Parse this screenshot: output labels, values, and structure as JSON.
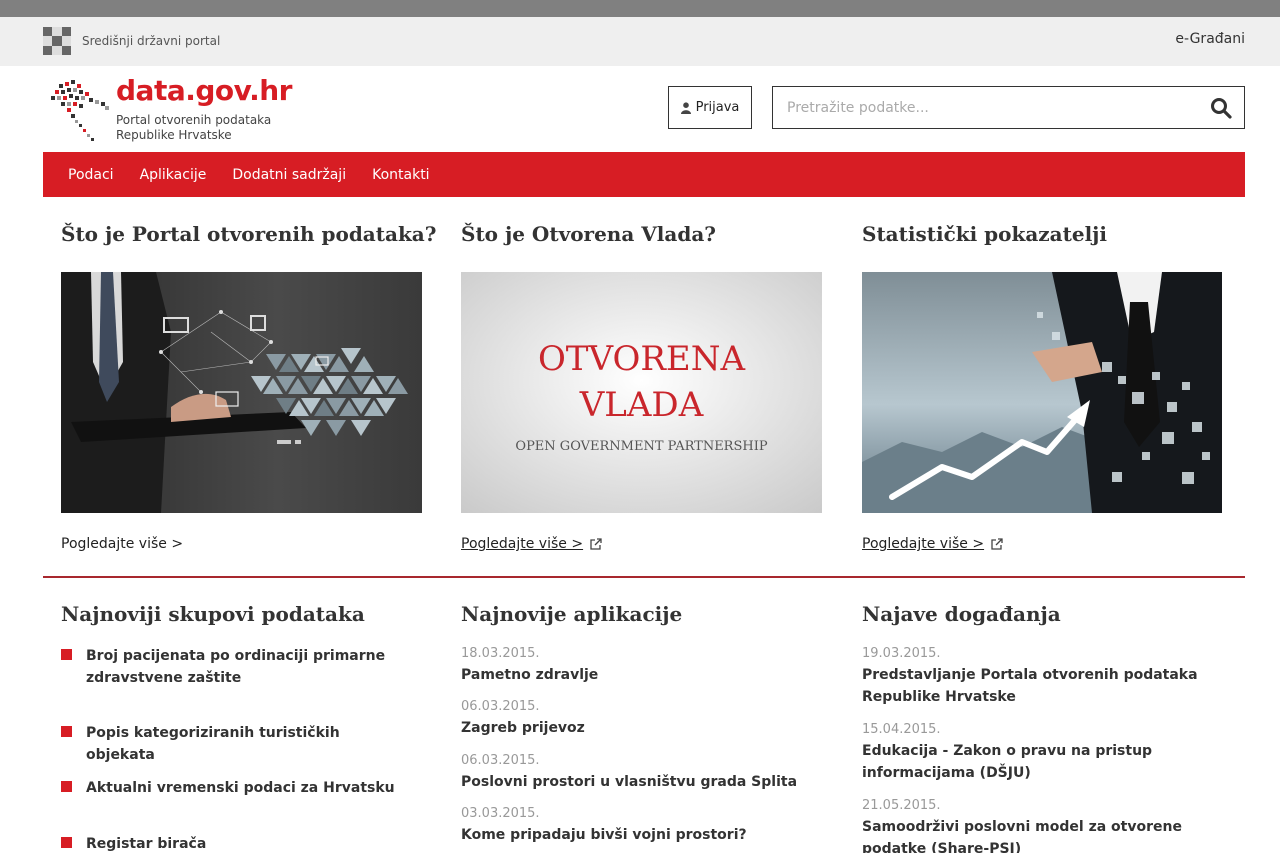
{
  "gov_bar": {
    "title": "Središnji državni portal",
    "right_link": "e-Građani"
  },
  "header": {
    "site_name": "data.gov.hr",
    "subtitle_line1": "Portal otvorenih podataka",
    "subtitle_line2": "Republike Hrvatske",
    "login_label": "Prijava",
    "search_placeholder": "Pretražite podatke..."
  },
  "nav": {
    "items": [
      "Podaci",
      "Aplikacije",
      "Dodatni sadržaji",
      "Kontakti"
    ]
  },
  "features": [
    {
      "title": "Što je Portal otvorenih podataka?",
      "link": "Pogledajte više >"
    },
    {
      "title": "Što je Otvorena Vlada?",
      "link": "Pogledajte više >",
      "image_text": {
        "line1": "OTVORENA",
        "line2": "VLADA",
        "line3": "OPEN GOVERNMENT PARTNERSHIP"
      }
    },
    {
      "title": "Statistički pokazatelji",
      "link": "Pogledajte više >"
    }
  ],
  "datasets": {
    "title": "Najnoviji skupovi podataka",
    "items": [
      "Broj pacijenata po ordinaciji primarne zdravstvene zaštite",
      "Popis kategoriziranih turističkih objekata",
      "Aktualni vremenski podaci za Hrvatsku",
      "Registar birača"
    ]
  },
  "apps": {
    "title": "Najnovije aplikacije",
    "items": [
      {
        "date": "18.03.2015.",
        "title": "Pametno zdravlje"
      },
      {
        "date": "06.03.2015.",
        "title": "Zagreb prijevoz"
      },
      {
        "date": "06.03.2015.",
        "title": "Poslovni prostori u vlasništvu grada Splita"
      },
      {
        "date": "03.03.2015.",
        "title": "Kome pripadaju bivši vojni prostori?"
      }
    ]
  },
  "events": {
    "title": "Najave događanja",
    "items": [
      {
        "date": "19.03.2015.",
        "title": "Predstavljanje Portala otvorenih podataka Republike Hrvatske"
      },
      {
        "date": "15.04.2015.",
        "title": "Edukacija - Zakon o pravu na pristup informacijama (DŠJU)"
      },
      {
        "date": "21.05.2015.",
        "title": "Samoodrživi poslovni model za otvorene podatke (Share-PSI)"
      }
    ]
  },
  "colors": {
    "brand_red": "#d71d24",
    "divider": "#a8282e"
  }
}
